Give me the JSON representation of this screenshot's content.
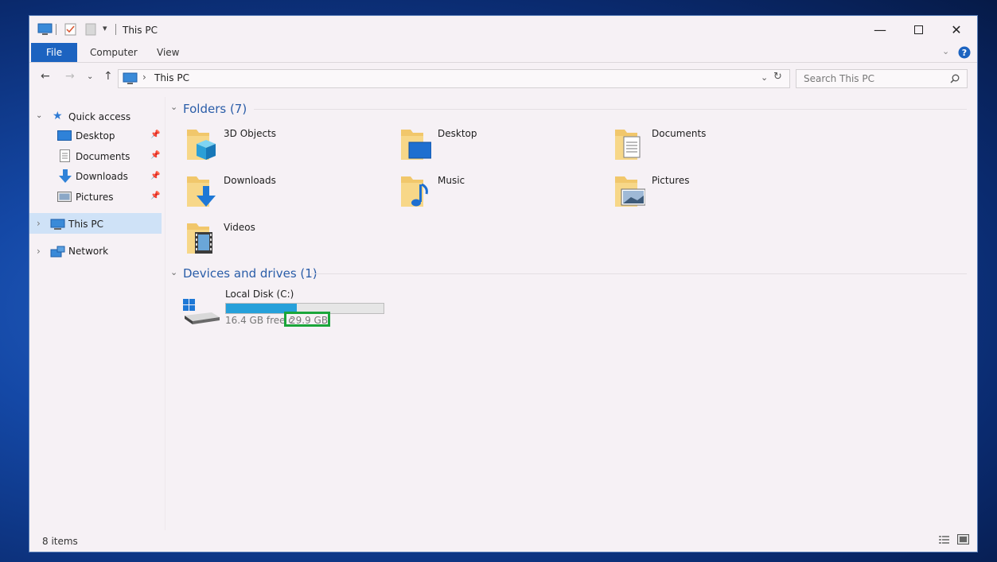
{
  "window": {
    "title": "This PC"
  },
  "ribbon": {
    "tabs": [
      "File",
      "Computer",
      "View"
    ]
  },
  "address": {
    "path_root_sep": "›",
    "path_label": "This PC"
  },
  "search": {
    "placeholder": "Search This PC"
  },
  "nav": {
    "quick_access": "Quick access",
    "pinned": [
      "Desktop",
      "Documents",
      "Downloads",
      "Pictures"
    ],
    "this_pc": "This PC",
    "network": "Network"
  },
  "folders": {
    "header": "Folders (7)",
    "items": [
      "3D Objects",
      "Desktop",
      "Documents",
      "Downloads",
      "Music",
      "Pictures",
      "Videos"
    ]
  },
  "drives": {
    "header": "Devices and drives (1)",
    "name": "Local Disk (C:)",
    "free_text": "16.4 GB free c",
    "total_text": "29.9 GB",
    "used_fraction": 0.45
  },
  "status": {
    "items": "8 items"
  },
  "colors": {
    "accent": "#1c63c0",
    "section": "#2a5da8",
    "highlight": "#1aa53a",
    "selection": "#cfe2f7"
  }
}
